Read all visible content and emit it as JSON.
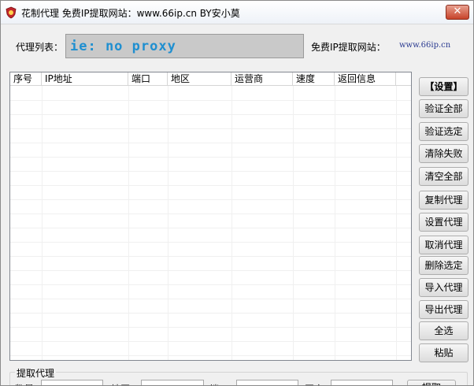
{
  "window": {
    "title": "花制代理 免费IP提取网站：www.66ip.cn   BY安小莫",
    "close_glyph": "✕"
  },
  "proxy": {
    "label": "代理列表：",
    "value": "ie: no proxy",
    "site_label": "免费IP提取网站：",
    "site_url": "www.66ip.cn"
  },
  "list": {
    "columns": [
      "序号",
      "IP地址",
      "端口",
      "地区",
      "运营商",
      "速度",
      "返回信息"
    ],
    "rows": []
  },
  "buttons": [
    "【设置】",
    "验证全部",
    "验证选定",
    "清除失败",
    "清空全部",
    "复制代理",
    "设置代理",
    "取消代理",
    "删除选定",
    "导入代理",
    "导出代理",
    "全选",
    "粘贴"
  ],
  "fetch_group": {
    "title": "提取代理",
    "labels": [
      "数量",
      "地区",
      "端口",
      "国家"
    ],
    "button": "提取"
  },
  "colors": {
    "proxy_text": "#1f8fd0",
    "proxy_bg": "#c9c9c9",
    "close_button": "#c7432a"
  }
}
